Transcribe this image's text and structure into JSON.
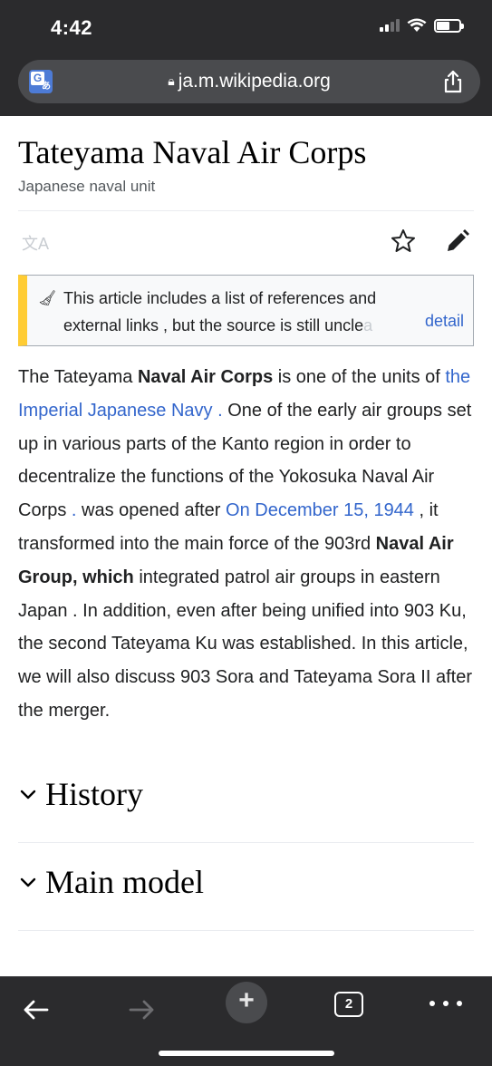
{
  "status_bar": {
    "time": "4:42"
  },
  "browser": {
    "url": "ja.m.wikipedia.org",
    "open_tabs": "2"
  },
  "article": {
    "title": "Tateyama Naval Air Corps",
    "subtitle": "Japanese naval unit",
    "notice": {
      "line1": "This article includes a list of references and",
      "line2": "external links , but the source is still uncle",
      "line2_fade": "a",
      "detail": "detail"
    },
    "paragraph": {
      "p1": "The Tateyama ",
      "b1": "Naval Air Corps",
      "p2": " is one of the units of ",
      "link1": "the Imperial Japanese Navy .",
      "p3": " One of the early air groups set up in various parts of the Kanto region in order to decentralize the functions of the Yokosuka Naval Air Corps ",
      "link2": ".",
      "p4": " was opened after ",
      "link3": "On December 15, 1944",
      "p5": " , it transformed into the main force of the 903rd ",
      "b2": "Naval Air Group, which",
      "p6": " integrated patrol air groups in eastern Japan . In addition, even after being unified into 903 Ku, the second Tateyama Ku was established. In this article, we will also discuss 903 Sora and Tateyama Sora II after the merger."
    },
    "sections": [
      {
        "title": "History"
      },
      {
        "title": "Main model"
      }
    ]
  },
  "colors": {
    "link": "#3366cc",
    "notice_accent": "#ffcc33",
    "chrome_bg": "#2b2b2d"
  }
}
